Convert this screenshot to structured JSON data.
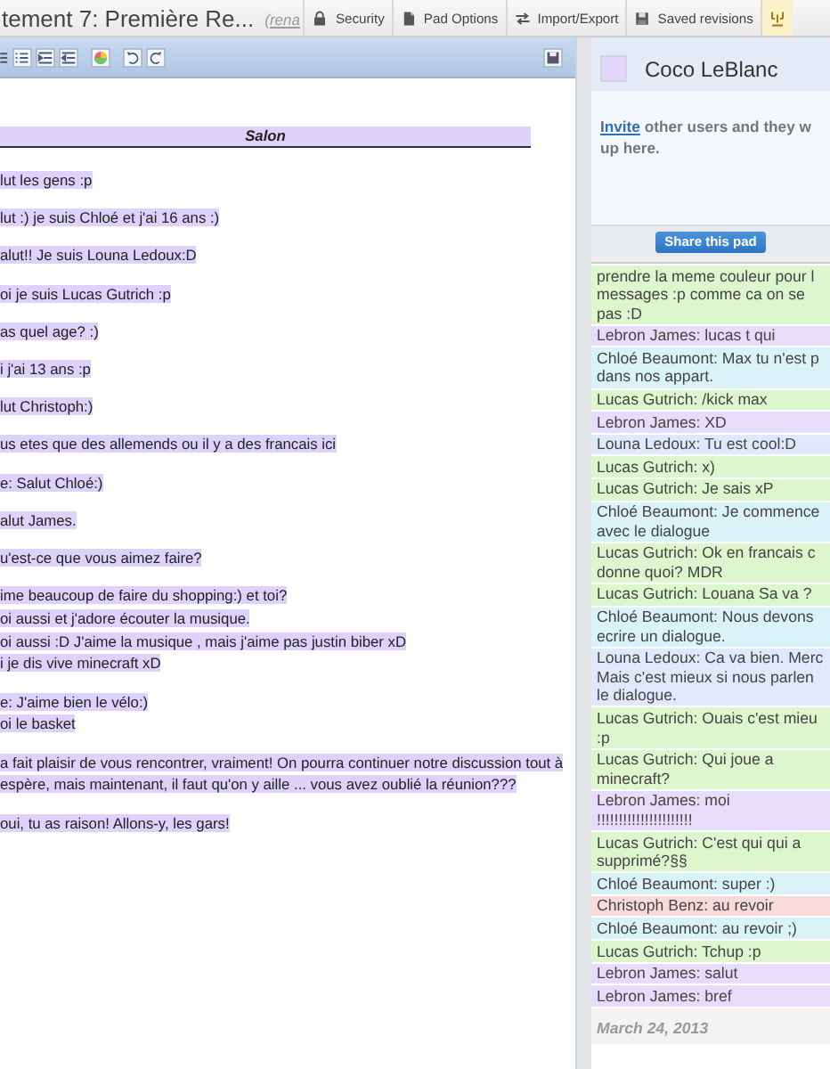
{
  "pad_title": "tement 7: Première Re...",
  "rename_link": "(rena",
  "menu": [
    {
      "kind": "security",
      "label": "Security",
      "selected": false
    },
    {
      "kind": "options",
      "label": "Pad Options",
      "selected": false
    },
    {
      "kind": "import",
      "label": "Import/Export",
      "selected": false
    },
    {
      "kind": "revisions",
      "label": "Saved revisions",
      "selected": false
    },
    {
      "kind": "embed",
      "selected": true
    }
  ],
  "editor": {
    "heading": "Salon",
    "paragraphs": [
      [
        "lut les gens :p"
      ],
      [
        "lut :) je suis Chloé et j'ai 16 ans :)"
      ],
      [
        "alut!! Je suis Louna Ledoux:D"
      ],
      [
        "oi je suis Lucas Gutrich :p"
      ],
      [
        "as quel age? :)"
      ],
      [
        "i j'ai 13 ans :p"
      ],
      [
        "lut Christoph:)"
      ],
      [
        "us etes que des allemends ou il y a des francais ici"
      ],
      [
        "e: Salut Chloé:)"
      ],
      [
        "alut James."
      ],
      [
        "u'est-ce que vous aimez faire?"
      ],
      [
        "ime beaucoup de faire du shopping:) et toi?",
        "oi aussi et j'adore écouter la musique.",
        "oi aussi :D J'aime la musique , mais j'aime pas justin biber xD",
        "i je dis vive minecraft xD"
      ],
      [
        "e: J'aime bien le vélo:)",
        "oi le basket"
      ],
      [
        "a fait plaisir de vous rencontrer, vraiment! On pourra continuer notre discussion tout à",
        "espère, mais maintenant, il faut qu'on y aille ... vous avez oublié la réunion???"
      ],
      [
        "oui, tu as raison! Allons-y, les gars!"
      ]
    ]
  },
  "users": {
    "me": {
      "name": "Coco LeBlanc",
      "color": "#e2d6fb"
    },
    "invite_link": "Invite",
    "invite_text": "other users and they w",
    "invite_text_2": "up here.",
    "share_button": "Share this pad"
  },
  "chat": {
    "messages": [
      {
        "color": "#ddf6cd",
        "lines": [
          "prendre la meme couleur pour l",
          "messages :p comme ca on se",
          "pas :D"
        ]
      },
      {
        "color": "#e6ddfa",
        "lines": [
          "Lebron James: lucas t qui"
        ]
      },
      {
        "color": "#d9f3f8",
        "lines": [
          "Chloé Beaumont: Max tu n'est p",
          "dans nos appart."
        ]
      },
      {
        "color": "#ddf6cd",
        "lines": [
          "Lucas Gutrich: /kick max"
        ]
      },
      {
        "color": "#e6ddfa",
        "lines": [
          "Lebron James: XD"
        ]
      },
      {
        "color": "#dfe9fb",
        "lines": [
          "Louna Ledoux: Tu est cool:D"
        ]
      },
      {
        "color": "#ddf6cd",
        "lines": [
          "Lucas Gutrich: x)"
        ]
      },
      {
        "color": "#ddf6cd",
        "lines": [
          "Lucas Gutrich: Je sais xP"
        ]
      },
      {
        "color": "#d9f3f8",
        "lines": [
          "Chloé Beaumont: Je commence",
          "avec le dialogue"
        ]
      },
      {
        "color": "#ddf6cd",
        "lines": [
          "Lucas Gutrich: Ok en francais c",
          "donne quoi? MDR"
        ]
      },
      {
        "color": "#ddf6cd",
        "lines": [
          "Lucas Gutrich: Louana Sa va ?"
        ]
      },
      {
        "color": "#d9f3f8",
        "lines": [
          "Chloé Beaumont: Nous devons",
          "ecrire un dialogue."
        ]
      },
      {
        "color": "#dfe9fb",
        "lines": [
          "Louna Ledoux: Ca va bien. Merc",
          "Mais c'est mieux si nous parlen",
          "le dialogue."
        ]
      },
      {
        "color": "#ddf6cd",
        "lines": [
          "Lucas Gutrich: Ouais c'est mieu",
          ":p"
        ]
      },
      {
        "color": "#ddf6cd",
        "lines": [
          "Lucas Gutrich: Qui joue a",
          "minecraft?"
        ]
      },
      {
        "color": "#e6ddfa",
        "lines": [
          "Lebron James: moi",
          "!!!!!!!!!!!!!!!!!!!!!!"
        ]
      },
      {
        "color": "#ddf6cd",
        "lines": [
          "Lucas Gutrich: C'est qui qui a",
          "supprimé?§§"
        ]
      },
      {
        "color": "#d9f3f8",
        "lines": [
          "Chloé Beaumont: super :)"
        ]
      },
      {
        "color": "#f8dada",
        "lines": [
          "Christoph Benz: au revoir"
        ]
      },
      {
        "color": "#d9f3f8",
        "lines": [
          "Chloé Beaumont: au revoir ;)"
        ]
      },
      {
        "color": "#ddf6cd",
        "lines": [
          "Lucas Gutrich: Tchup :p"
        ]
      },
      {
        "color": "#e6ddfa",
        "lines": [
          "Lebron James: salut"
        ]
      },
      {
        "color": "#e6ddfa",
        "lines": [
          "Lebron James: bref"
        ]
      }
    ],
    "date": "March 24, 2013"
  }
}
